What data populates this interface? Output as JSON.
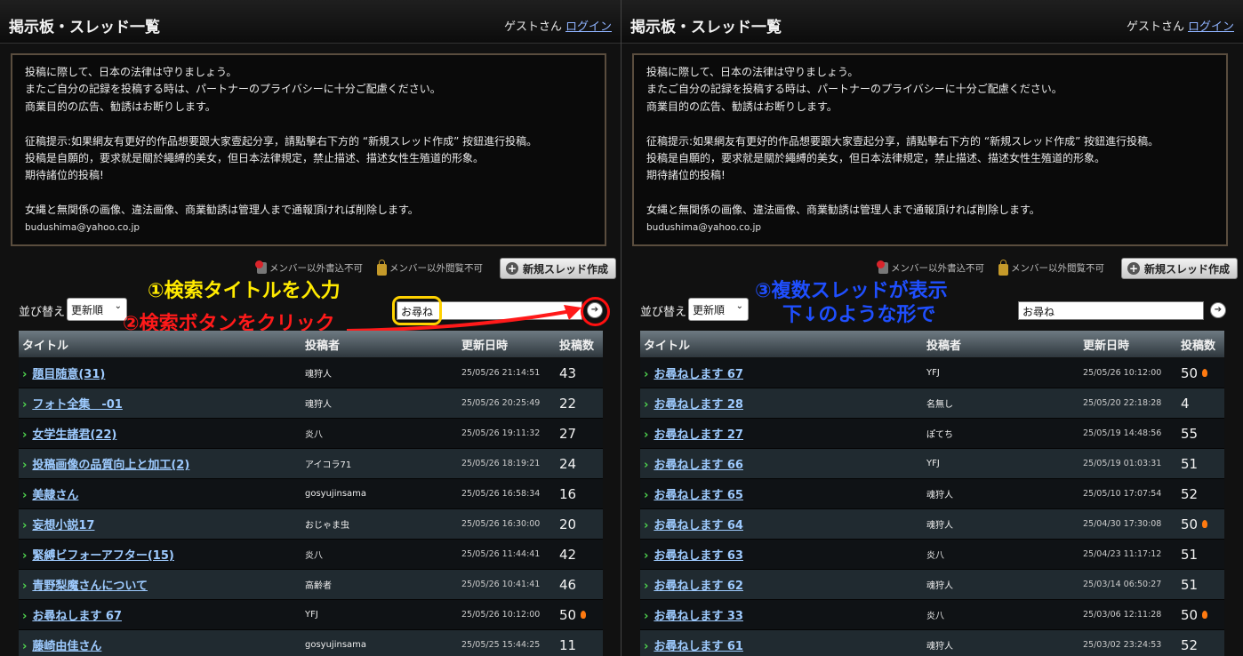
{
  "header": {
    "title": "掲示板・スレッド一覧",
    "guest": "ゲストさん",
    "login": "ログイン"
  },
  "notice": {
    "lines": [
      "投稿に際して、日本の法律は守りましょう。",
      "またご自分の記録を投稿する時は、パートナーのプライバシーに十分ご配慮ください。",
      "商業目的の広告、勧誘はお断りします。",
      "",
      "征稿提示:如果網友有更好的作品想要跟大家壹起分享，請點擊右下方的 “新規スレッド作成” 按鈕進行投稿。",
      "投稿是自願的，要求就是關於繩縛的美女，但日本法律規定，禁止描述、描述女性生殖道的形象。",
      "期待諸位的投稿!",
      "",
      "女縄と無関係の画像、違法画像、商業勧誘は管理人まで通報頂ければ削除します。"
    ],
    "email": "budushima@yahoo.co.jp"
  },
  "toolbar": {
    "perm_write": "メンバー以外書込不可",
    "perm_read": "メンバー以外閲覧不可",
    "new_thread": "新規スレッド作成",
    "sort_label": "並び替え",
    "sort_selected": "更新順",
    "search_value": "お尋ね"
  },
  "columns": {
    "title": "タイトル",
    "author": "投稿者",
    "updated": "更新日時",
    "count": "投稿数"
  },
  "annotations": {
    "step1": "①検索タイトルを入力",
    "step2": "②検索ボタンをクリック",
    "step3_line1": "③複数スレッドが表示",
    "step3_line2": "下↓のような形で"
  },
  "left_threads": [
    {
      "title": "題目随意(31)",
      "author": "魂狩人",
      "date": "25/05/26 21:14:51",
      "count": "43",
      "hot": false
    },
    {
      "title": "フォト全集　-01",
      "author": "魂狩人",
      "date": "25/05/26 20:25:49",
      "count": "22",
      "hot": false
    },
    {
      "title": "女学生諸君(22)",
      "author": "炎八",
      "date": "25/05/26 19:11:32",
      "count": "27",
      "hot": false
    },
    {
      "title": "投稿画像の品質向上と加工(2)",
      "author": "アイコラ71",
      "date": "25/05/26 18:19:21",
      "count": "24",
      "hot": false
    },
    {
      "title": "美隷さん",
      "author": "gosyujinsama",
      "date": "25/05/26 16:58:34",
      "count": "16",
      "hot": false
    },
    {
      "title": "妄想小説17",
      "author": "おじゃま虫",
      "date": "25/05/26 16:30:00",
      "count": "20",
      "hot": false
    },
    {
      "title": "緊縛ビフォーアフター(15)",
      "author": "炎八",
      "date": "25/05/26 11:44:41",
      "count": "42",
      "hot": false
    },
    {
      "title": "青野梨魔さんについて",
      "author": "高齢者",
      "date": "25/05/26 10:41:41",
      "count": "46",
      "hot": false
    },
    {
      "title": "お尋ねします 67",
      "author": "YFJ",
      "date": "25/05/26 10:12:00",
      "count": "50",
      "hot": true
    },
    {
      "title": "藤崎由佳さん",
      "author": "gosyujinsama",
      "date": "25/05/25 15:44:25",
      "count": "11",
      "hot": false
    }
  ],
  "right_threads": [
    {
      "title": "お尋ねします 67",
      "author": "YFJ",
      "date": "25/05/26 10:12:00",
      "count": "50",
      "hot": true
    },
    {
      "title": "お尋ねします 28",
      "author": "名無し",
      "date": "25/05/20 22:18:28",
      "count": "4",
      "hot": false
    },
    {
      "title": "お尋ねします 27",
      "author": "ぽてち",
      "date": "25/05/19 14:48:56",
      "count": "55",
      "hot": false
    },
    {
      "title": "お尋ねします 66",
      "author": "YFJ",
      "date": "25/05/19 01:03:31",
      "count": "51",
      "hot": false
    },
    {
      "title": "お尋ねします 65",
      "author": "魂狩人",
      "date": "25/05/10 17:07:54",
      "count": "52",
      "hot": false
    },
    {
      "title": "お尋ねします 64",
      "author": "魂狩人",
      "date": "25/04/30 17:30:08",
      "count": "50",
      "hot": true
    },
    {
      "title": "お尋ねします 63",
      "author": "炎八",
      "date": "25/04/23 11:17:12",
      "count": "51",
      "hot": false
    },
    {
      "title": "お尋ねします 62",
      "author": "魂狩人",
      "date": "25/03/14 06:50:27",
      "count": "51",
      "hot": false
    },
    {
      "title": "お尋ねします 33",
      "author": "炎八",
      "date": "25/03/06 12:11:28",
      "count": "50",
      "hot": true
    },
    {
      "title": "お尋ねします 61",
      "author": "魂狩人",
      "date": "25/03/02 23:24:53",
      "count": "52",
      "hot": false
    }
  ]
}
